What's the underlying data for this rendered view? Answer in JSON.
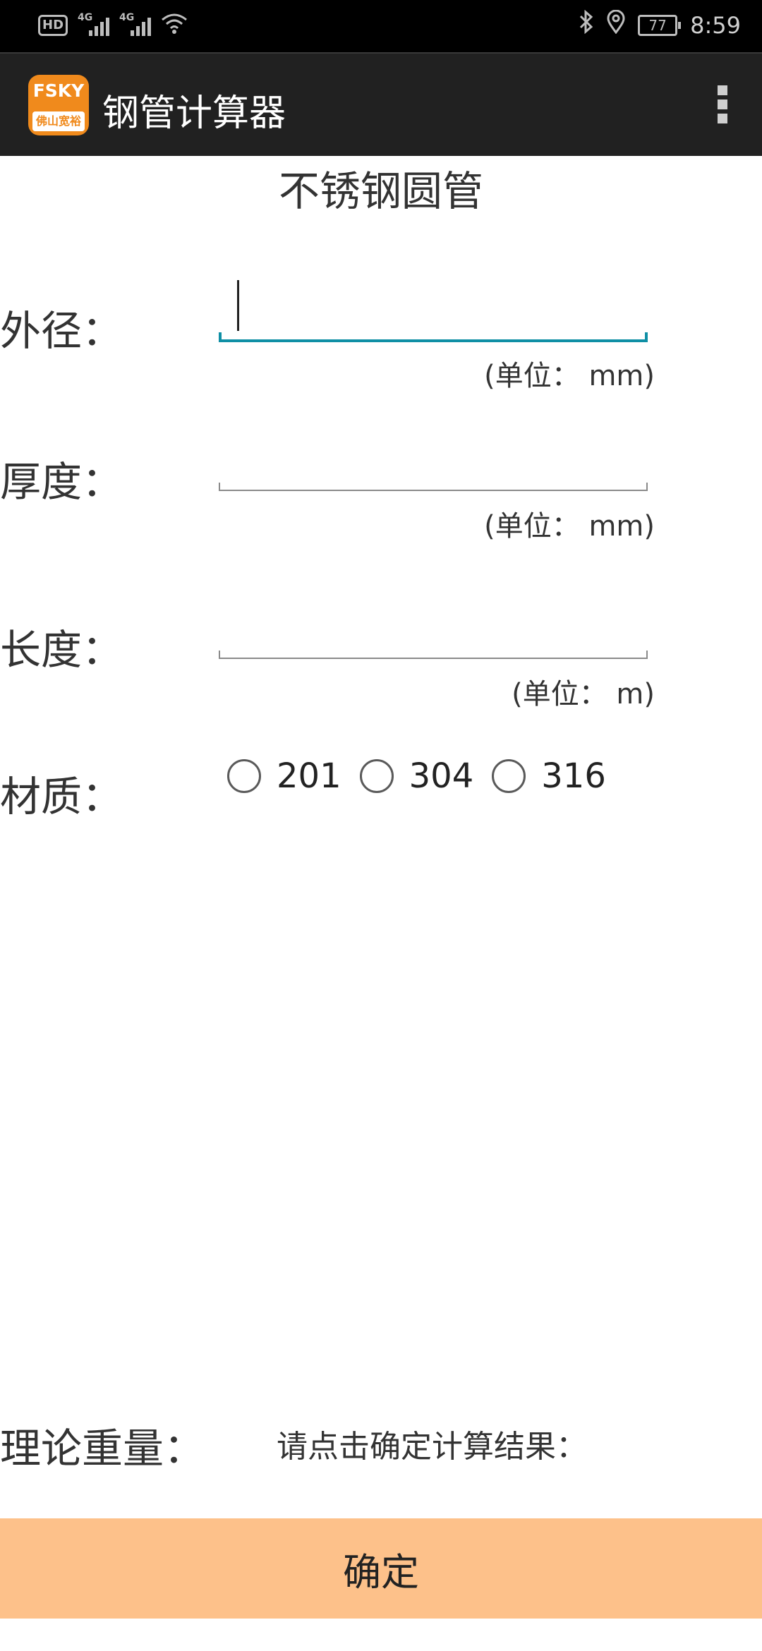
{
  "status_bar": {
    "hd_label": "HD",
    "sim_slot": "1",
    "signal1_label": "4G",
    "signal2_label": "4G",
    "battery": "77",
    "time": "8:59",
    "icons": [
      "hd-icon",
      "signal-icon",
      "signal-icon",
      "wifi-icon",
      "bluetooth-icon",
      "location-icon",
      "battery-icon"
    ]
  },
  "app_bar": {
    "logo_top": "FSKY",
    "logo_bottom": "佛山宽裕",
    "title": "钢管计算器",
    "menu_icon": "overflow-menu-icon"
  },
  "form": {
    "title": "不锈钢圆管",
    "outer_diameter": {
      "label": "外径：",
      "value": "",
      "unit": "(单位：  mm)"
    },
    "thickness": {
      "label": "厚度：",
      "value": "",
      "unit": "(单位：  mm)"
    },
    "length": {
      "label": "长度：",
      "value": "",
      "unit": "(单位：    m)"
    },
    "material": {
      "label": "材质：",
      "options": [
        "201",
        "304",
        "316"
      ]
    }
  },
  "result": {
    "label": "理论重量：",
    "value": "请点击确定计算结果："
  },
  "actions": {
    "confirm_label": "确定"
  },
  "colors": {
    "status_bar_bg": "#000000",
    "app_bar_bg": "#212121",
    "accent": "#0f8fa5",
    "button_bg": "#fdc18a",
    "logo_orange": "#f08a1c"
  }
}
